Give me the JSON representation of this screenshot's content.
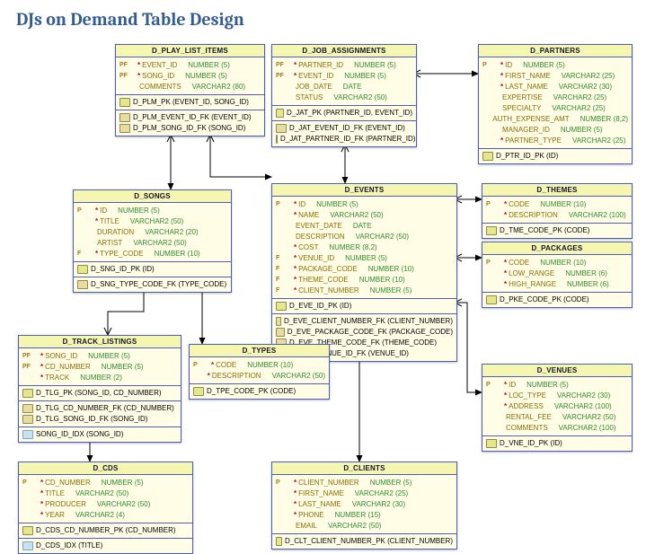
{
  "title": "DJs on Demand Table Design",
  "entities": {
    "d_play_list_items": {
      "name": "D_PLAY_LIST_ITEMS",
      "cols": [
        {
          "keys": "PF",
          "req": true,
          "name": "EVENT_ID",
          "type": "NUMBER (5)"
        },
        {
          "keys": "PF",
          "req": true,
          "name": "SONG_ID",
          "type": "NUMBER (5)"
        },
        {
          "keys": "",
          "req": false,
          "name": "COMMENTS",
          "type": "VARCHAR2 (80)"
        }
      ],
      "idx": [
        {
          "t": "pk",
          "txt": "D_PLM_PK (EVENT_ID, SONG_ID)"
        },
        {
          "t": "fk",
          "txt": "D_PLM_EVENT_ID_FK (EVENT_ID)"
        },
        {
          "t": "fk",
          "txt": "D_PLM_SONG_ID_FK (SONG_ID)"
        }
      ]
    },
    "d_job_assignments": {
      "name": "D_JOB_ASSIGNMENTS",
      "cols": [
        {
          "keys": "PF",
          "req": true,
          "name": "PARTNER_ID",
          "type": "NUMBER (5)"
        },
        {
          "keys": "PF",
          "req": true,
          "name": "EVENT_ID",
          "type": "NUMBER (5)"
        },
        {
          "keys": "",
          "req": false,
          "name": "JOB_DATE",
          "type": "DATE"
        },
        {
          "keys": "",
          "req": false,
          "name": "STATUS",
          "type": "VARCHAR2 (50)"
        }
      ],
      "idx": [
        {
          "t": "pk",
          "txt": "D_JAT_PK (PARTNER_ID, EVENT_ID)"
        },
        {
          "t": "fk",
          "txt": "D_JAT_EVENT_ID_FK (EVENT_ID)"
        },
        {
          "t": "fk",
          "txt": "D_JAT_PARTNER_ID_FK (PARTNER_ID)"
        }
      ]
    },
    "d_partners": {
      "name": "D_PARTNERS",
      "cols": [
        {
          "keys": "P",
          "req": true,
          "name": "ID",
          "type": "NUMBER (5)"
        },
        {
          "keys": "",
          "req": true,
          "name": "FIRST_NAME",
          "type": "VARCHAR2 (25)"
        },
        {
          "keys": "",
          "req": true,
          "name": "LAST_NAME",
          "type": "VARCHAR2 (30)"
        },
        {
          "keys": "",
          "req": false,
          "name": "EXPERTISE",
          "type": "VARCHAR2 (25)"
        },
        {
          "keys": "",
          "req": false,
          "name": "SPECIALTY",
          "type": "VARCHAR2 (25)"
        },
        {
          "keys": "",
          "req": false,
          "name": "AUTH_EXPENSE_AMT",
          "type": "NUMBER (8,2)"
        },
        {
          "keys": "",
          "req": false,
          "name": "MANAGER_ID",
          "type": "NUMBER (5)"
        },
        {
          "keys": "",
          "req": true,
          "name": "PARTNER_TYPE",
          "type": "VARCHAR2 (25)"
        }
      ],
      "idx": [
        {
          "t": "pk",
          "txt": "D_PTR_ID_PK (ID)"
        }
      ]
    },
    "d_songs": {
      "name": "D_SONGS",
      "cols": [
        {
          "keys": "P",
          "req": true,
          "name": "ID",
          "type": "NUMBER (5)"
        },
        {
          "keys": "",
          "req": true,
          "name": "TITLE",
          "type": "VARCHAR2 (50)"
        },
        {
          "keys": "",
          "req": false,
          "name": "DURATION",
          "type": "VARCHAR2 (20)"
        },
        {
          "keys": "",
          "req": false,
          "name": "ARTIST",
          "type": "VARCHAR2 (50)"
        },
        {
          "keys": "F",
          "req": true,
          "name": "TYPE_CODE",
          "type": "NUMBER (10)"
        }
      ],
      "idx": [
        {
          "t": "pk",
          "txt": "D_SNG_ID_PK (ID)"
        },
        {
          "t": "fk",
          "txt": "D_SNG_TYPE_CODE_FK (TYPE_CODE)"
        }
      ]
    },
    "d_events": {
      "name": "D_EVENTS",
      "cols": [
        {
          "keys": "P",
          "req": true,
          "name": "ID",
          "type": "NUMBER (5)"
        },
        {
          "keys": "",
          "req": true,
          "name": "NAME",
          "type": "VARCHAR2 (50)"
        },
        {
          "keys": "",
          "req": false,
          "name": "EVENT_DATE",
          "type": "DATE"
        },
        {
          "keys": "",
          "req": false,
          "name": "DESCRIPTION",
          "type": "VARCHAR2 (50)"
        },
        {
          "keys": "",
          "req": true,
          "name": "COST",
          "type": "NUMBER (8,2)"
        },
        {
          "keys": "F",
          "req": true,
          "name": "VENUE_ID",
          "type": "NUMBER (5)"
        },
        {
          "keys": "F",
          "req": true,
          "name": "PACKAGE_CODE",
          "type": "NUMBER (10)"
        },
        {
          "keys": "F",
          "req": true,
          "name": "THEME_CODE",
          "type": "NUMBER (10)"
        },
        {
          "keys": "F",
          "req": true,
          "name": "CLIENT_NUMBER",
          "type": "NUMBER (5)"
        }
      ],
      "idx": [
        {
          "t": "pk",
          "txt": "D_EVE_ID_PK (ID)"
        },
        {
          "t": "fk",
          "txt": "D_EVE_CLIENT_NUMBER_FK (CLIENT_NUMBER)"
        },
        {
          "t": "fk",
          "txt": "D_EVE_PACKAGE_CODE_FK (PACKAGE_CODE)"
        },
        {
          "t": "fk",
          "txt": "D_EVE_THEME_CODE_FK (THEME_CODE)"
        },
        {
          "t": "fk",
          "txt": "D_EVE_VENUE_ID_FK (VENUE_ID)"
        }
      ]
    },
    "d_themes": {
      "name": "D_THEMES",
      "cols": [
        {
          "keys": "P",
          "req": true,
          "name": "CODE",
          "type": "NUMBER (10)"
        },
        {
          "keys": "",
          "req": true,
          "name": "DESCRIPTION",
          "type": "VARCHAR2 (100)"
        }
      ],
      "idx": [
        {
          "t": "pk",
          "txt": "D_TME_CODE_PK (CODE)"
        }
      ]
    },
    "d_packages": {
      "name": "D_PACKAGES",
      "cols": [
        {
          "keys": "P",
          "req": true,
          "name": "CODE",
          "type": "NUMBER (10)"
        },
        {
          "keys": "",
          "req": true,
          "name": "LOW_RANGE",
          "type": "NUMBER (6)"
        },
        {
          "keys": "",
          "req": true,
          "name": "HIGH_RANGE",
          "type": "NUMBER (6)"
        }
      ],
      "idx": [
        {
          "t": "pk",
          "txt": "D_PKE_CODE_PK (CODE)"
        }
      ]
    },
    "d_track_listings": {
      "name": "D_TRACK_LISTINGS",
      "cols": [
        {
          "keys": "PF",
          "req": true,
          "name": "SONG_ID",
          "type": "NUMBER (5)"
        },
        {
          "keys": "PF",
          "req": true,
          "name": "CD_NUMBER",
          "type": "NUMBER (5)"
        },
        {
          "keys": "",
          "req": true,
          "name": "TRACK",
          "type": "NUMBER (2)"
        }
      ],
      "idx": [
        {
          "t": "pk",
          "txt": "D_TLG_PK (SONG_ID, CD_NUMBER)"
        },
        {
          "t": "fk",
          "txt": "D_TLG_CD_NUMBER_FK (CD_NUMBER)"
        },
        {
          "t": "fk",
          "txt": "D_TLG_SONG_ID_FK (SONG_ID)"
        },
        {
          "t": "idx",
          "txt": "SONG_ID_IDX (SONG_ID)"
        }
      ]
    },
    "d_types": {
      "name": "D_TYPES",
      "cols": [
        {
          "keys": "P",
          "req": true,
          "name": "CODE",
          "type": "NUMBER (10)"
        },
        {
          "keys": "",
          "req": true,
          "name": "DESCRIPTION",
          "type": "VARCHAR2 (50)"
        }
      ],
      "idx": [
        {
          "t": "pk",
          "txt": "D_TPE_CODE_PK (CODE)"
        }
      ]
    },
    "d_venues": {
      "name": "D_VENUES",
      "cols": [
        {
          "keys": "P",
          "req": true,
          "name": "ID",
          "type": "NUMBER (5)"
        },
        {
          "keys": "",
          "req": true,
          "name": "LOC_TYPE",
          "type": "VARCHAR2 (30)"
        },
        {
          "keys": "",
          "req": true,
          "name": "ADDRESS",
          "type": "VARCHAR2 (100)"
        },
        {
          "keys": "",
          "req": false,
          "name": "RENTAL_FEE",
          "type": "VARCHAR2 (50)"
        },
        {
          "keys": "",
          "req": false,
          "name": "COMMENTS",
          "type": "VARCHAR2 (100)"
        }
      ],
      "idx": [
        {
          "t": "pk",
          "txt": "D_VNE_ID_PK (ID)"
        }
      ]
    },
    "d_cds": {
      "name": "D_CDS",
      "cols": [
        {
          "keys": "P",
          "req": true,
          "name": "CD_NUMBER",
          "type": "NUMBER (5)"
        },
        {
          "keys": "",
          "req": true,
          "name": "TITLE",
          "type": "VARCHAR2 (50)"
        },
        {
          "keys": "",
          "req": true,
          "name": "PRODUCER",
          "type": "VARCHAR2 (50)"
        },
        {
          "keys": "",
          "req": true,
          "name": "YEAR",
          "type": "VARCHAR2 (4)"
        }
      ],
      "idx": [
        {
          "t": "pk",
          "txt": "D_CDS_CD_NUMBER_PK (CD_NUMBER)"
        },
        {
          "t": "idx",
          "txt": "D_CDS_IDX (TITLE)"
        }
      ]
    },
    "d_clients": {
      "name": "D_CLIENTS",
      "cols": [
        {
          "keys": "P",
          "req": true,
          "name": "CLIENT_NUMBER",
          "type": "NUMBER (5)"
        },
        {
          "keys": "",
          "req": true,
          "name": "FIRST_NAME",
          "type": "VARCHAR2 (25)"
        },
        {
          "keys": "",
          "req": true,
          "name": "LAST_NAME",
          "type": "VARCHAR2 (30)"
        },
        {
          "keys": "",
          "req": true,
          "name": "PHONE",
          "type": "NUMBER (15)"
        },
        {
          "keys": "",
          "req": false,
          "name": "EMAIL",
          "type": "VARCHAR2 (50)"
        }
      ],
      "idx": [
        {
          "t": "pk",
          "txt": "D_CLT_CLIENT_NUMBER_PK (CLIENT_NUMBER)"
        }
      ]
    }
  },
  "relations": [
    {
      "from": "d_play_list_items",
      "to": "d_events"
    },
    {
      "from": "d_play_list_items",
      "to": "d_songs"
    },
    {
      "from": "d_job_assignments",
      "to": "d_events"
    },
    {
      "from": "d_job_assignments",
      "to": "d_partners"
    },
    {
      "from": "d_songs",
      "to": "d_types"
    },
    {
      "from": "d_events",
      "to": "d_themes"
    },
    {
      "from": "d_events",
      "to": "d_packages"
    },
    {
      "from": "d_events",
      "to": "d_venues"
    },
    {
      "from": "d_events",
      "to": "d_clients"
    },
    {
      "from": "d_track_listings",
      "to": "d_songs"
    },
    {
      "from": "d_track_listings",
      "to": "d_cds"
    }
  ]
}
